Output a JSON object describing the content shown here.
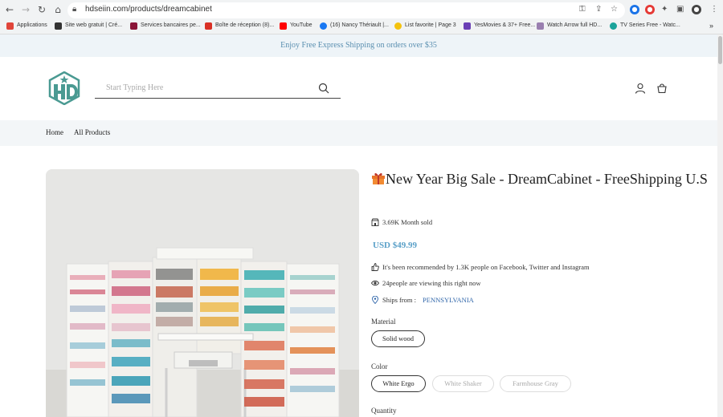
{
  "browser": {
    "url": "hdseiin.com/products/dreamcabinet",
    "bookmarks": [
      {
        "label": "Applications",
        "color": "#e0453a"
      },
      {
        "label": "Site web gratuit | Cré...",
        "color": "#333333"
      },
      {
        "label": "Services bancaires pe...",
        "color": "#8a1538"
      },
      {
        "label": "Boîte de réception (8)...",
        "color": "#d93025"
      },
      {
        "label": "YouTube",
        "color": "#ff0000"
      },
      {
        "label": "(16) Nancy Thériault |...",
        "color": "#1877f2"
      },
      {
        "label": "List favorite | Page 3",
        "color": "#f4c20d"
      },
      {
        "label": "YesMovies & 37+ Free...",
        "color": "#6a3fb5"
      },
      {
        "label": "Watch Arrow full HD...",
        "color": "#9a7fb0"
      },
      {
        "label": "TV Series Free - Watc...",
        "color": "#1aa39a"
      }
    ]
  },
  "store": {
    "announcement": "Enjoy Free Express Shipping on orders over $35",
    "search_placeholder": "Start Typing Here",
    "nav": [
      "Home",
      "All Products"
    ]
  },
  "product": {
    "title": "New Year Big Sale - DreamCabinet - FreeShipping U.S",
    "sold": "3.69K Month sold",
    "price": "USD $49.99",
    "recommend": "It's been recommended by 1.3K people on Facebook, Twitter and Instagram",
    "viewing": "24people are viewing this right now",
    "ships_label": "Ships from :",
    "ships_value": "PENNSYLVANIA",
    "material_label": "Material",
    "material_options": [
      "Solid wood"
    ],
    "color_label": "Color",
    "color_options": [
      "White Ergo",
      "White Shaker",
      "Farmhouse Gray"
    ],
    "quantity_label": "Quantity"
  },
  "colors": {
    "accent": "#5aa0c8",
    "link": "#2c63a8",
    "announce_bg": "#eef4f8",
    "logo": "#4a9a92"
  }
}
